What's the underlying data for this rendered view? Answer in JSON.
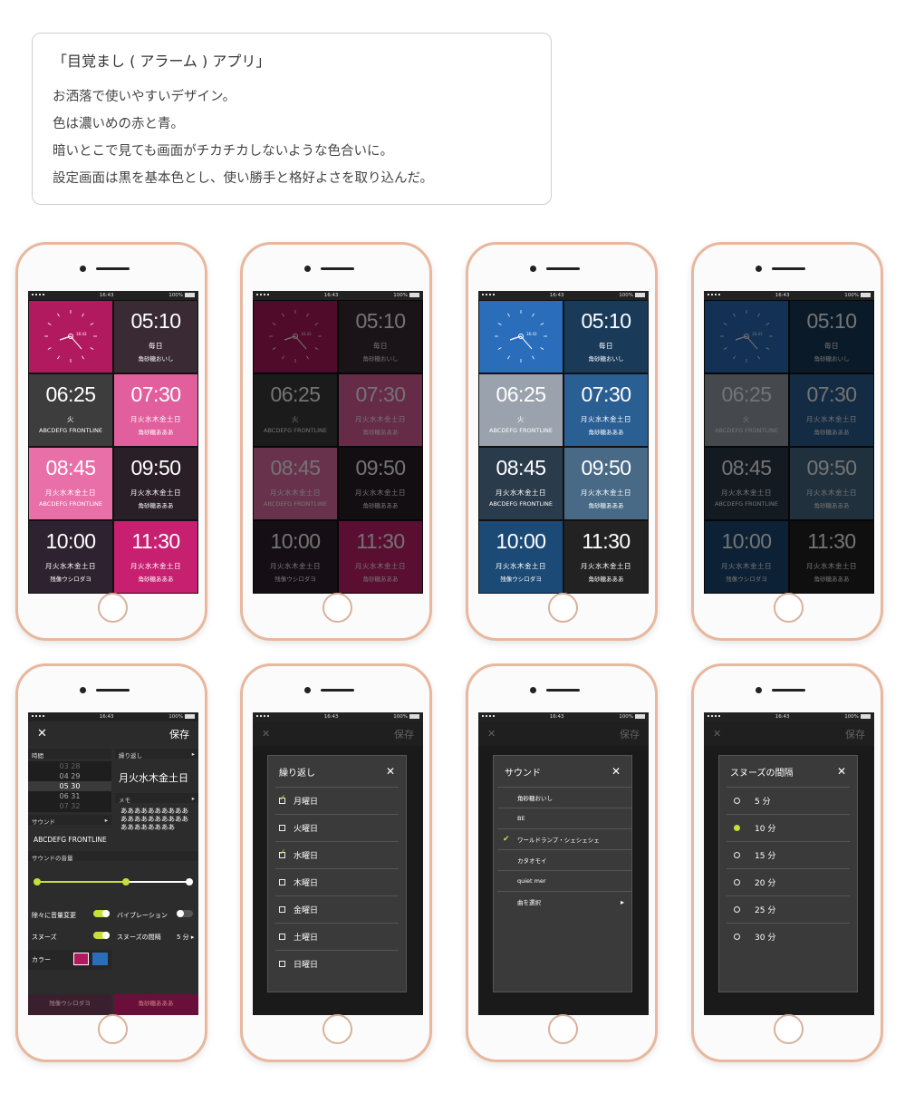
{
  "description": {
    "title": "「目覚まし ( アラーム ) アプリ」",
    "lines": [
      "お洒落で使いやすいデザイン。",
      "色は濃いめの赤と青。",
      "暗いとこで見ても画面がチカチカしないような色合いに。",
      "設定画面は黒を基本色とし、使い勝手と格好よさを取り込んだ。"
    ]
  },
  "status": {
    "time": "16:43",
    "battery": "100%"
  },
  "colors": {
    "pink": "#b11a5e",
    "hot_pink": "#e25f9d",
    "blue": "#2a6dbb",
    "navy": "#1a3a5a",
    "lime": "#c8de3a"
  },
  "tiles": [
    {
      "time": "",
      "days": "",
      "sub": ""
    },
    {
      "time": "05:10",
      "days": "毎日",
      "sub": "角砂糖おいし"
    },
    {
      "time": "06:25",
      "days": "火",
      "sub": "ABCDEFG FRONTLINE"
    },
    {
      "time": "07:30",
      "days": "月火水木金土日",
      "sub": "角砂糖あああ"
    },
    {
      "time": "08:45",
      "days": "月火水木金土日",
      "sub": "ABCDEFG FRONTLINE"
    },
    {
      "time": "09:50",
      "days": "月火水木金土日",
      "sub": "角砂糖あああ"
    },
    {
      "time": "10:00",
      "days": "月火水木金土日",
      "sub": "残像ウシロダヨ"
    },
    {
      "time": "11:30",
      "days": "月火水木金土日",
      "sub": "角砂糖あああ"
    }
  ],
  "clock": {
    "label": "16:43"
  },
  "settings": {
    "close": "✕",
    "save": "保存",
    "time_label": "時間",
    "repeat_label": "繰り返し",
    "picker": [
      "03  28",
      "04  29",
      "05  30",
      "06  31",
      "07  32"
    ],
    "repeat_days": "月火水木金土日",
    "memo_label": "メモ",
    "memo": "ああああああああああああああああああああああああああああ",
    "sound_label": "サウンド",
    "sound_value": "ABCDEFG FRONTLINE",
    "volume_label": "サウンドの音量",
    "fade_label": "除々に音量変更",
    "vibration_label": "バイブレーション",
    "snooze_label": "スヌーズ",
    "snooze_interval_label": "スヌーズの間隔",
    "snooze_interval_value": "5 分",
    "color_label": "カラー",
    "footer_left": "残像ウシロダヨ",
    "footer_right": "角砂糖あああ"
  },
  "repeat_modal": {
    "title": "繰り返し",
    "items": [
      {
        "label": "月曜日",
        "checked": true
      },
      {
        "label": "火曜日",
        "checked": false
      },
      {
        "label": "水曜日",
        "checked": true
      },
      {
        "label": "木曜日",
        "checked": false
      },
      {
        "label": "金曜日",
        "checked": false
      },
      {
        "label": "土曜日",
        "checked": false
      },
      {
        "label": "日曜日",
        "checked": false
      }
    ]
  },
  "sound_modal": {
    "title": "サウンド",
    "items": [
      "角砂糖おいし",
      "BE",
      "ワールドランプ・シェシェシェ",
      "カタオモイ",
      "quiet mer",
      "曲を選択"
    ],
    "selected": 2
  },
  "snooze_modal": {
    "title": "スヌーズの間隔",
    "items": [
      "5 分",
      "10 分",
      "15 分",
      "20 分",
      "25 分",
      "30 分"
    ],
    "selected": 1
  }
}
